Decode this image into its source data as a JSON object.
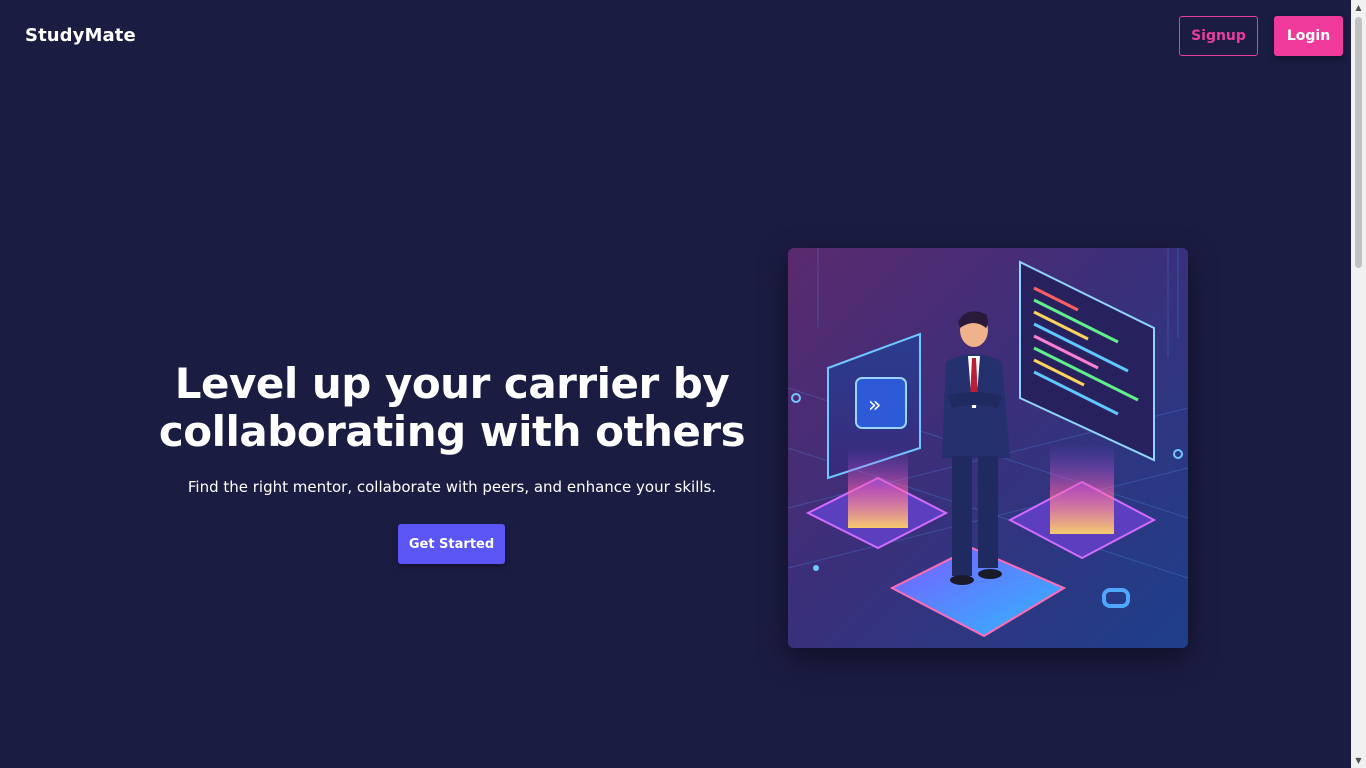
{
  "navbar": {
    "logo": "StudyMate",
    "signup_label": "Signup",
    "login_label": "Login"
  },
  "hero": {
    "title_line1": "Level up your carrier by",
    "title_line2": "collaborating with others",
    "subtitle": "Find the right mentor, collaborate with peers, and enhance your skills.",
    "cta_label": "Get Started"
  },
  "colors": {
    "background": "#1b1c42",
    "accent_pink": "#ef3a9c",
    "accent_purple": "#5c55f5"
  }
}
